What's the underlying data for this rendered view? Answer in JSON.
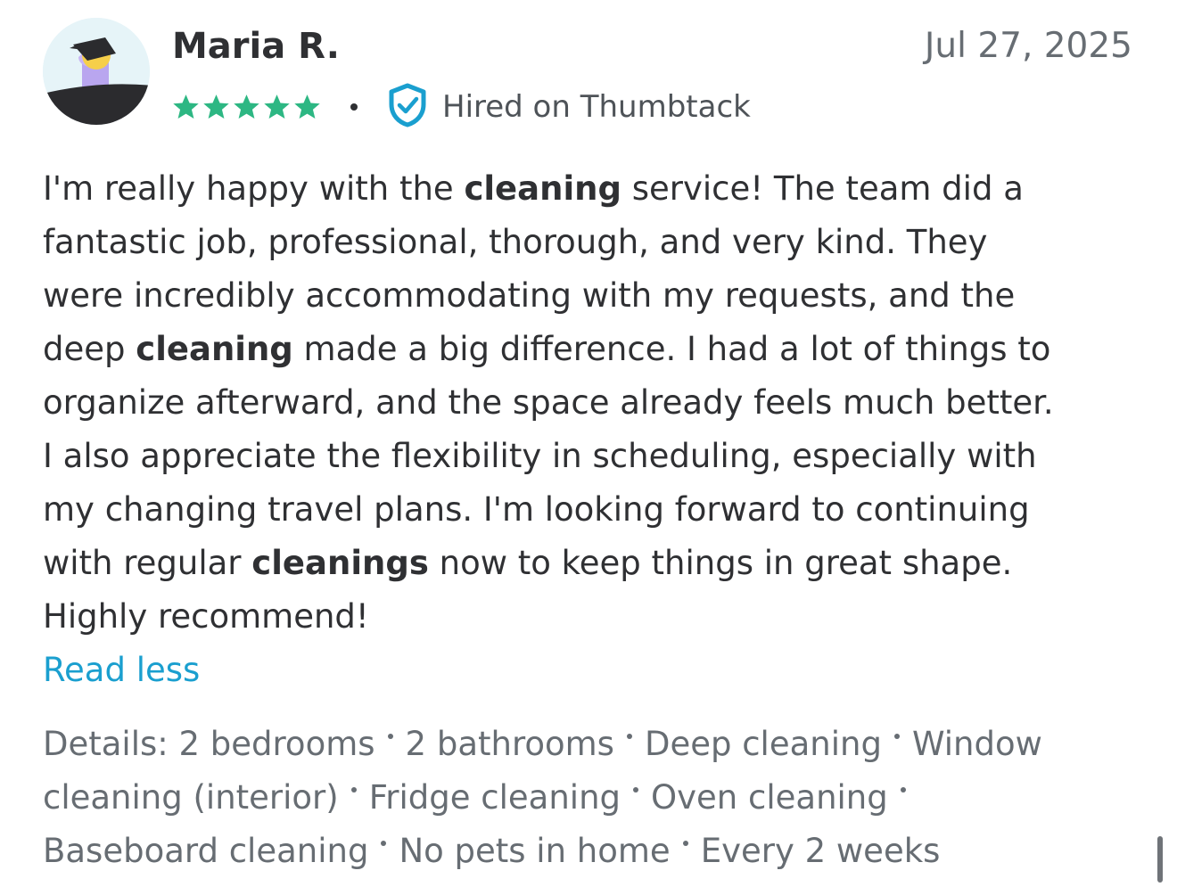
{
  "review": {
    "reviewer_name": "Maria R.",
    "date": "Jul 27, 2025",
    "rating": 5,
    "rating_max": 5,
    "star_color": "#2db783",
    "hired_badge": "Hired on Thumbtack",
    "body_lines": [
      [
        "I'm really happy with the ",
        "cleaning",
        " service! The team did a"
      ],
      [
        "fantastic job, professional, thorough, and very kind. They"
      ],
      [
        "were incredibly accommodating with my requests, and the"
      ],
      [
        "deep ",
        "cleaning",
        " made a big difference. I had a lot of things to"
      ],
      [
        "organize afterward, and the space already feels much better."
      ],
      [
        "I also appreciate the flexibility in scheduling, especially with"
      ],
      [
        "my changing travel plans. I'm looking forward to continuing"
      ],
      [
        "with regular ",
        "cleanings",
        " now to keep things in great shape."
      ],
      [
        "Highly recommend!"
      ]
    ],
    "read_less_label": "Read less",
    "link_color": "#1a9fcf"
  },
  "details": {
    "label": "Details:",
    "lines": [
      [
        "2 bedrooms",
        "2 bathrooms",
        "Deep cleaning",
        "Window"
      ],
      [
        "cleaning (interior)",
        "Fridge cleaning",
        "Oven cleaning",
        ""
      ],
      [
        "Baseboard cleaning",
        "No pets in home",
        "Every 2 weeks"
      ]
    ]
  }
}
